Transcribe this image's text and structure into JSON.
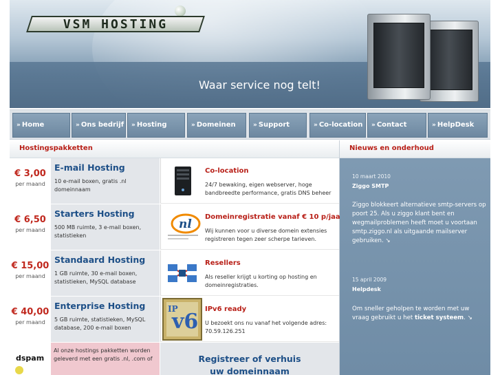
{
  "header": {
    "logo_text": "VSM HOSTING",
    "tagline": "Waar service nog telt!"
  },
  "nav": {
    "items": [
      {
        "label": "Home"
      },
      {
        "label": "Ons bedrijf"
      },
      {
        "label": "Hosting"
      },
      {
        "label": "Domeinen"
      },
      {
        "label": "Support"
      },
      {
        "label": "Co-location"
      },
      {
        "label": "Contact"
      },
      {
        "label": "HelpDesk"
      }
    ],
    "arrow": "»"
  },
  "sections": {
    "packages_title": "Hostingspakketten",
    "news_title": "Nieuws en onderhoud"
  },
  "packages": [
    {
      "price": "€ 3,00",
      "per": "per maand",
      "name": "E-mail Hosting",
      "desc": "10 e-mail boxen, gratis .nl domeinnaam"
    },
    {
      "price": "€ 6,50",
      "per": "per maand",
      "name": "Starters Hosting",
      "desc": "500 MB ruimte, 3 e-mail boxen, statistieken"
    },
    {
      "price": "€ 15,00",
      "per": "per maand",
      "name": "Standaard Hosting",
      "desc": "1 GB ruimte, 30 e-mail boxen, statistieken, MySQL database"
    },
    {
      "price": "€ 40,00",
      "per": "per maand",
      "name": "Enterprise Hosting",
      "desc": "5 GB ruimte, statistieken, MySQL database, 200 e-mail boxen"
    }
  ],
  "services": [
    {
      "title": "Co-location",
      "text": "24/7 bewaking, eigen webserver, hoge bandbreedte performance, gratis DNS beheer",
      "icon": "server-icon"
    },
    {
      "title": "Domeinregistratie vanaf € 10 p/jaar",
      "text": "Wij kunnen voor u diverse domein extensies registreren tegen zeer scherpe tarieven.",
      "icon": "nl-domain-icon"
    },
    {
      "title": "Resellers",
      "text": "Als reseller krijgt u korting op hosting en domeinregistraties.",
      "icon": "network-icon"
    },
    {
      "title": "IPv6 ready",
      "text": "U bezoekt ons nu vanaf het volgende adres: 70.59.126.251",
      "icon": "ipv6-icon"
    }
  ],
  "bottom": {
    "pink_text": "Al onze hostings pakketten worden geleverd met een gratis .nl, .com of",
    "spam_label": "dspam",
    "register_line1": "Registreer of verhuis",
    "register_line2": "uw domeinnaam"
  },
  "news": [
    {
      "date": "10 maart 2010",
      "title": "Ziggo SMTP",
      "text": "Ziggo blokkeert alternatieve smtp-servers op poort 25. Als u ziggo klant bent en wegmailproblemen heeft moet u voortaan smtp.ziggo.nl als uitgaande mailserver gebruiken. ↘"
    },
    {
      "date": "15 april 2009",
      "title": "Helpdesk",
      "text_before": "Om sneller geholpen te worden met uw vraag gebruikt u het ",
      "text_bold": "ticket systeem",
      "text_after": ". ↘"
    }
  ],
  "colors": {
    "accent_red": "#b81f17",
    "title_blue": "#1d4f87",
    "nav_blue": "#7b96ae",
    "news_bg": "#7691aa"
  }
}
